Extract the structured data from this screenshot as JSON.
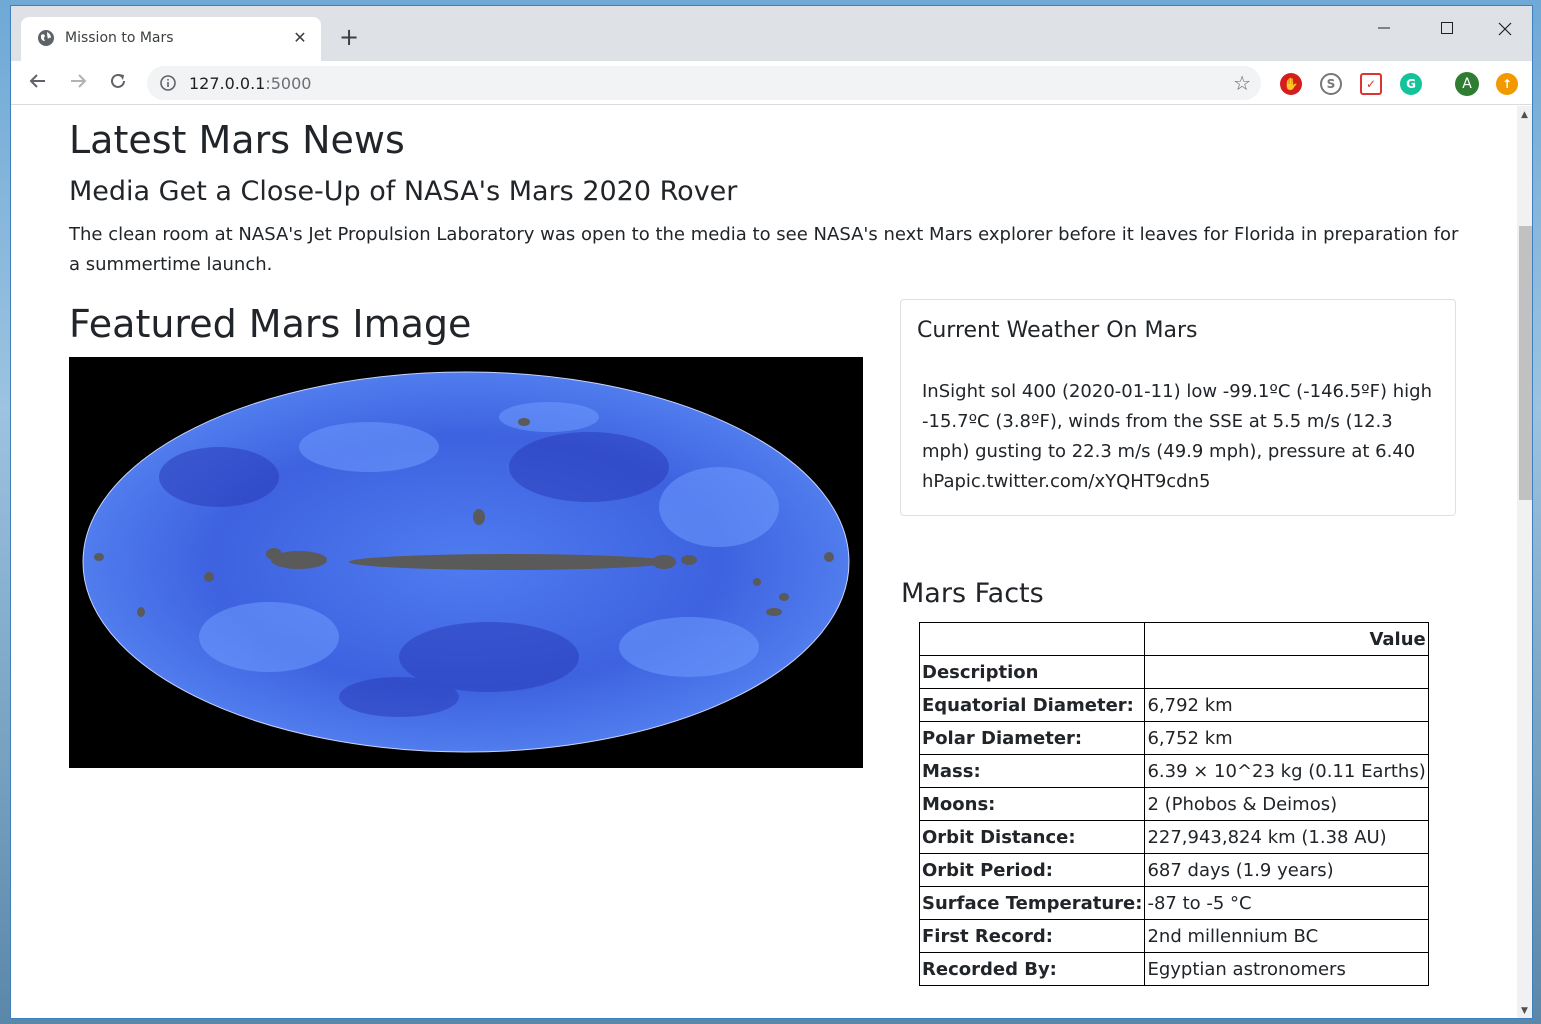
{
  "browser": {
    "tab_title": "Mission to Mars",
    "tab_close": "✕",
    "new_tab": "+",
    "url_host": "127.0.0.1",
    "url_port": ":5000",
    "profile_initial": "A"
  },
  "news": {
    "heading": "Latest Mars News",
    "title": "Media Get a Close-Up of NASA's Mars 2020 Rover",
    "body": "The clean room at NASA's Jet Propulsion Laboratory was open to the media to see NASA's next Mars explorer before it leaves for Florida in preparation for a summertime launch."
  },
  "featured": {
    "heading": "Featured Mars Image"
  },
  "weather": {
    "title": "Current Weather On Mars",
    "body": "InSight sol 400 (2020-01-11) low -99.1ºC (-146.5ºF) high -15.7ºC (3.8ºF), winds from the SSE at 5.5 m/s (12.3 mph) gusting to 22.3 m/s (49.9 mph), pressure at 6.40 hPapic.twitter.com/xYQHT9cdn5"
  },
  "facts": {
    "heading": "Mars Facts",
    "value_header": "Value",
    "index_name": "Description",
    "rows": [
      {
        "label": "Equatorial Diameter:",
        "value": "6,792 km"
      },
      {
        "label": "Polar Diameter:",
        "value": "6,752 km"
      },
      {
        "label": "Mass:",
        "value": "6.39 × 10^23 kg (0.11 Earths)"
      },
      {
        "label": "Moons:",
        "value": "2 (Phobos & Deimos)"
      },
      {
        "label": "Orbit Distance:",
        "value": "227,943,824 km (1.38 AU)"
      },
      {
        "label": "Orbit Period:",
        "value": "687 days (1.9 years)"
      },
      {
        "label": "Surface Temperature:",
        "value": "-87 to -5 °C"
      },
      {
        "label": "First Record:",
        "value": "2nd millennium BC"
      },
      {
        "label": "Recorded By:",
        "value": "Egyptian astronomers"
      }
    ]
  }
}
